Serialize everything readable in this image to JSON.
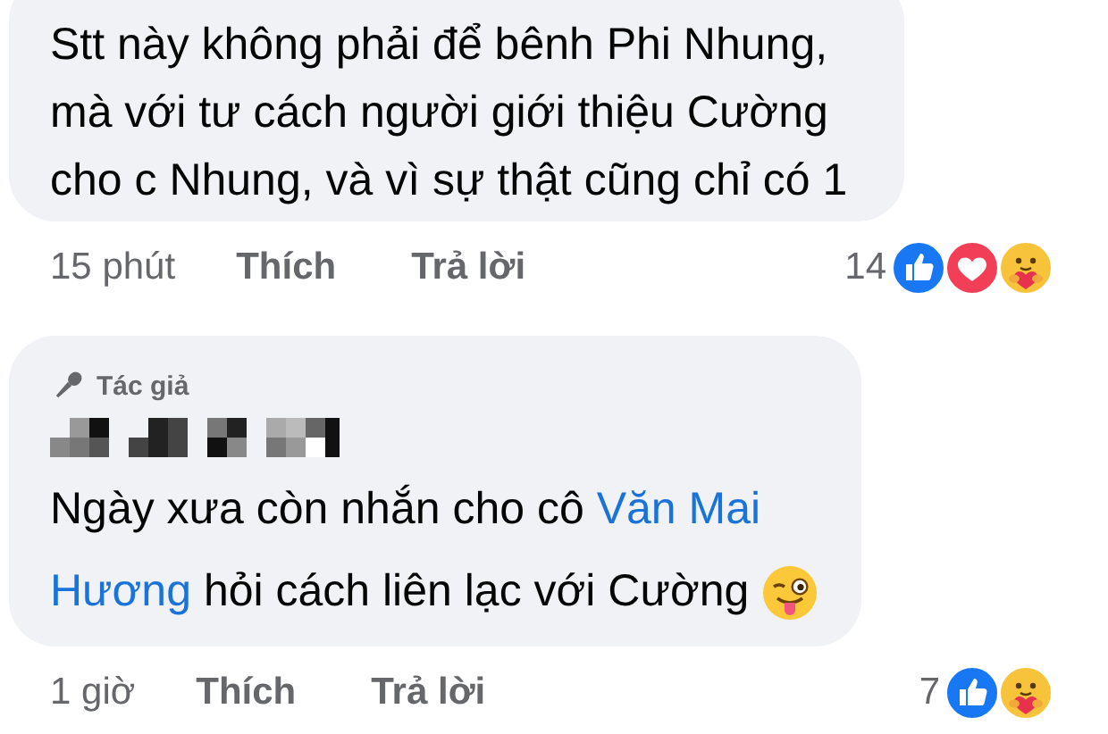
{
  "comments": [
    {
      "lines": [
        [
          {
            "kind": "text",
            "text": "Stt này không phải để bênh Phi Nhung,"
          }
        ],
        [
          {
            "kind": "text",
            "text": "mà với tư cách người giới thiệu Cường"
          }
        ],
        [
          {
            "kind": "text",
            "text": "cho c Nhung, và vì sự thật cũng chỉ có 1"
          }
        ]
      ],
      "time": "15 phút",
      "actions": [
        "Thích",
        "Trả lời"
      ],
      "reaction_count": "14",
      "reactions": [
        {
          "kind": "like"
        },
        {
          "kind": "love"
        },
        {
          "kind": "care"
        }
      ]
    },
    {
      "badge": "Tác giả",
      "lines": [
        [
          {
            "kind": "text",
            "text": "Ngày xưa còn nhắn cho cô "
          },
          {
            "kind": "mention",
            "text": "Văn Mai"
          }
        ],
        [
          {
            "kind": "mention",
            "text": "Hương"
          },
          {
            "kind": "text",
            "text": " hỏi cách liên lạc với Cường "
          },
          {
            "kind": "emoji"
          }
        ]
      ],
      "time": "1 giờ",
      "actions": [
        "Thích",
        "Trả lời"
      ],
      "reaction_count": "7",
      "reactions": [
        {
          "kind": "like"
        },
        {
          "kind": "care"
        }
      ]
    }
  ]
}
